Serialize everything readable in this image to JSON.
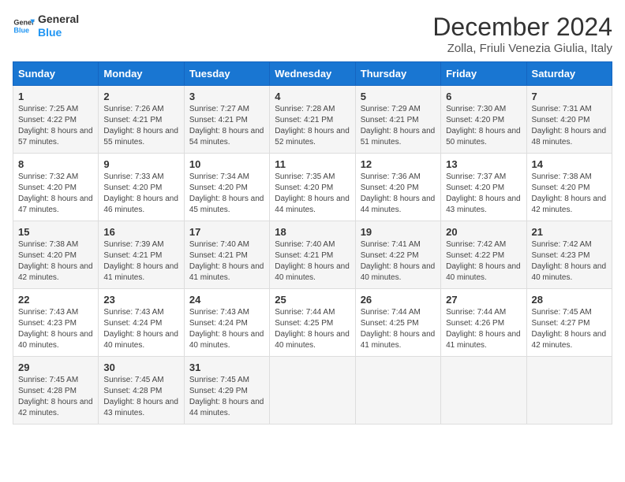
{
  "logo": {
    "text_general": "General",
    "text_blue": "Blue"
  },
  "title": "December 2024",
  "subtitle": "Zolla, Friuli Venezia Giulia, Italy",
  "days_of_week": [
    "Sunday",
    "Monday",
    "Tuesday",
    "Wednesday",
    "Thursday",
    "Friday",
    "Saturday"
  ],
  "weeks": [
    [
      {
        "day": "1",
        "sunrise": "7:25 AM",
        "sunset": "4:22 PM",
        "daylight": "8 hours and 57 minutes."
      },
      {
        "day": "2",
        "sunrise": "7:26 AM",
        "sunset": "4:21 PM",
        "daylight": "8 hours and 55 minutes."
      },
      {
        "day": "3",
        "sunrise": "7:27 AM",
        "sunset": "4:21 PM",
        "daylight": "8 hours and 54 minutes."
      },
      {
        "day": "4",
        "sunrise": "7:28 AM",
        "sunset": "4:21 PM",
        "daylight": "8 hours and 52 minutes."
      },
      {
        "day": "5",
        "sunrise": "7:29 AM",
        "sunset": "4:21 PM",
        "daylight": "8 hours and 51 minutes."
      },
      {
        "day": "6",
        "sunrise": "7:30 AM",
        "sunset": "4:20 PM",
        "daylight": "8 hours and 50 minutes."
      },
      {
        "day": "7",
        "sunrise": "7:31 AM",
        "sunset": "4:20 PM",
        "daylight": "8 hours and 48 minutes."
      }
    ],
    [
      {
        "day": "8",
        "sunrise": "7:32 AM",
        "sunset": "4:20 PM",
        "daylight": "8 hours and 47 minutes."
      },
      {
        "day": "9",
        "sunrise": "7:33 AM",
        "sunset": "4:20 PM",
        "daylight": "8 hours and 46 minutes."
      },
      {
        "day": "10",
        "sunrise": "7:34 AM",
        "sunset": "4:20 PM",
        "daylight": "8 hours and 45 minutes."
      },
      {
        "day": "11",
        "sunrise": "7:35 AM",
        "sunset": "4:20 PM",
        "daylight": "8 hours and 44 minutes."
      },
      {
        "day": "12",
        "sunrise": "7:36 AM",
        "sunset": "4:20 PM",
        "daylight": "8 hours and 44 minutes."
      },
      {
        "day": "13",
        "sunrise": "7:37 AM",
        "sunset": "4:20 PM",
        "daylight": "8 hours and 43 minutes."
      },
      {
        "day": "14",
        "sunrise": "7:38 AM",
        "sunset": "4:20 PM",
        "daylight": "8 hours and 42 minutes."
      }
    ],
    [
      {
        "day": "15",
        "sunrise": "7:38 AM",
        "sunset": "4:20 PM",
        "daylight": "8 hours and 42 minutes."
      },
      {
        "day": "16",
        "sunrise": "7:39 AM",
        "sunset": "4:21 PM",
        "daylight": "8 hours and 41 minutes."
      },
      {
        "day": "17",
        "sunrise": "7:40 AM",
        "sunset": "4:21 PM",
        "daylight": "8 hours and 41 minutes."
      },
      {
        "day": "18",
        "sunrise": "7:40 AM",
        "sunset": "4:21 PM",
        "daylight": "8 hours and 40 minutes."
      },
      {
        "day": "19",
        "sunrise": "7:41 AM",
        "sunset": "4:22 PM",
        "daylight": "8 hours and 40 minutes."
      },
      {
        "day": "20",
        "sunrise": "7:42 AM",
        "sunset": "4:22 PM",
        "daylight": "8 hours and 40 minutes."
      },
      {
        "day": "21",
        "sunrise": "7:42 AM",
        "sunset": "4:23 PM",
        "daylight": "8 hours and 40 minutes."
      }
    ],
    [
      {
        "day": "22",
        "sunrise": "7:43 AM",
        "sunset": "4:23 PM",
        "daylight": "8 hours and 40 minutes."
      },
      {
        "day": "23",
        "sunrise": "7:43 AM",
        "sunset": "4:24 PM",
        "daylight": "8 hours and 40 minutes."
      },
      {
        "day": "24",
        "sunrise": "7:43 AM",
        "sunset": "4:24 PM",
        "daylight": "8 hours and 40 minutes."
      },
      {
        "day": "25",
        "sunrise": "7:44 AM",
        "sunset": "4:25 PM",
        "daylight": "8 hours and 40 minutes."
      },
      {
        "day": "26",
        "sunrise": "7:44 AM",
        "sunset": "4:25 PM",
        "daylight": "8 hours and 41 minutes."
      },
      {
        "day": "27",
        "sunrise": "7:44 AM",
        "sunset": "4:26 PM",
        "daylight": "8 hours and 41 minutes."
      },
      {
        "day": "28",
        "sunrise": "7:45 AM",
        "sunset": "4:27 PM",
        "daylight": "8 hours and 42 minutes."
      }
    ],
    [
      {
        "day": "29",
        "sunrise": "7:45 AM",
        "sunset": "4:28 PM",
        "daylight": "8 hours and 42 minutes."
      },
      {
        "day": "30",
        "sunrise": "7:45 AM",
        "sunset": "4:28 PM",
        "daylight": "8 hours and 43 minutes."
      },
      {
        "day": "31",
        "sunrise": "7:45 AM",
        "sunset": "4:29 PM",
        "daylight": "8 hours and 44 minutes."
      },
      null,
      null,
      null,
      null
    ]
  ]
}
